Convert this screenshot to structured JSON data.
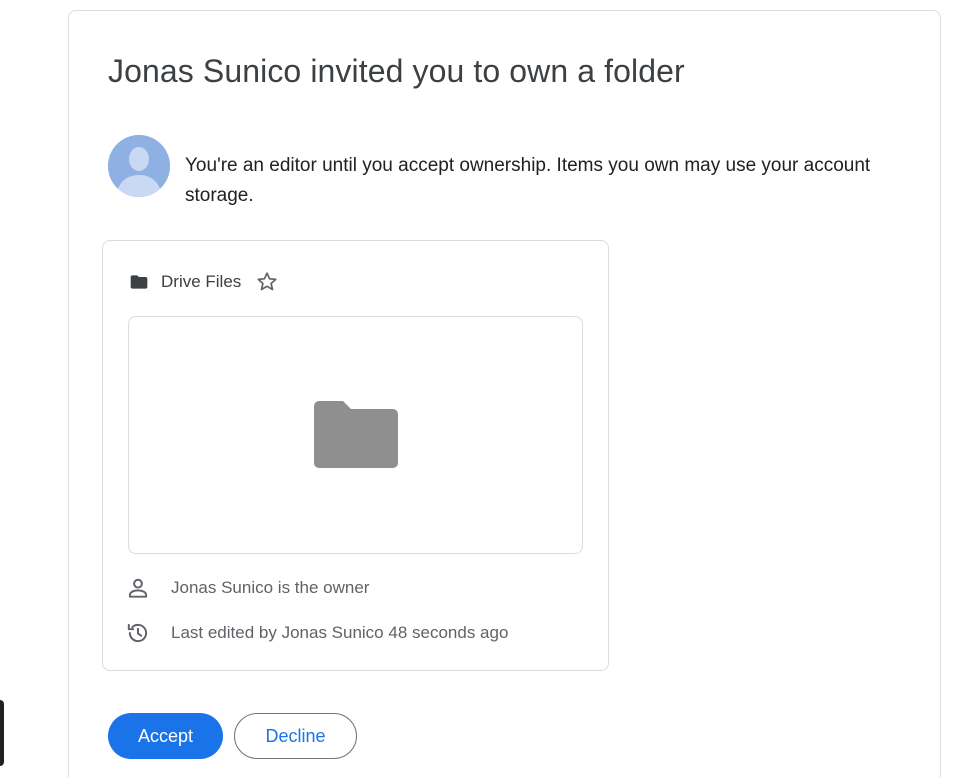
{
  "invite": {
    "title": "Jonas Sunico invited you to own a folder",
    "message": "You're an editor until you accept ownership. Items you own may use your account storage."
  },
  "file": {
    "name": "Drive Files",
    "icon": "folder-icon",
    "starred": false
  },
  "details": {
    "owner_text": "Jonas Sunico is the owner",
    "last_edited_text": "Last edited by Jonas Sunico 48 seconds ago"
  },
  "actions": {
    "accept_label": "Accept",
    "decline_label": "Decline"
  },
  "colors": {
    "accent": "#1a73e8",
    "border": "#dadce0",
    "title_text": "#3c4043",
    "secondary_text": "#5f6368",
    "folder_gray": "#8f8f8f",
    "avatar_blue": "#8fb0e2"
  }
}
